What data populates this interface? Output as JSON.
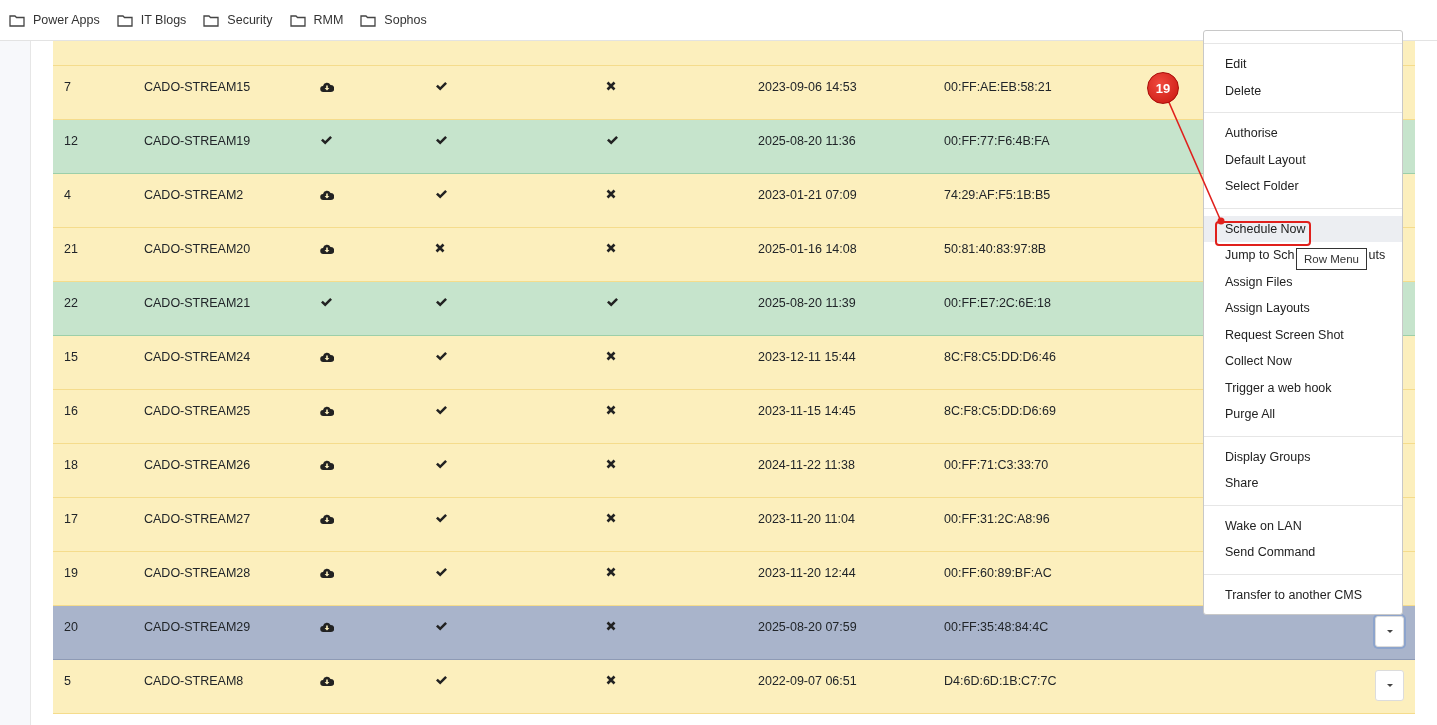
{
  "bookmarks": [
    {
      "label": "Power Apps"
    },
    {
      "label": "IT Blogs"
    },
    {
      "label": "Security"
    },
    {
      "label": "RMM"
    },
    {
      "label": "Sophos"
    }
  ],
  "rows": [
    {
      "id": "7",
      "name": "CADO-STREAM15",
      "kind": "warning",
      "selected": false,
      "flags": [
        {
          "kind": "cloud"
        },
        {
          "kind": "check"
        },
        {
          "kind": "cross"
        }
      ],
      "date": "2023-09-06 14:53",
      "mac": "00:FF:AE:EB:58:21"
    },
    {
      "id": "12",
      "name": "CADO-STREAM19",
      "kind": "success",
      "selected": false,
      "flags": [
        {
          "kind": "check"
        },
        {
          "kind": "check"
        },
        {
          "kind": "check"
        }
      ],
      "date": "2025-08-20 11:36",
      "mac": "00:FF:77:F6:4B:FA"
    },
    {
      "id": "4",
      "name": "CADO-STREAM2",
      "kind": "warning",
      "selected": false,
      "flags": [
        {
          "kind": "cloud"
        },
        {
          "kind": "check"
        },
        {
          "kind": "cross"
        }
      ],
      "date": "2023-01-21 07:09",
      "mac": "74:29:AF:F5:1B:B5"
    },
    {
      "id": "21",
      "name": "CADO-STREAM20",
      "kind": "warning",
      "selected": false,
      "flags": [
        {
          "kind": "cloud"
        },
        {
          "kind": "cross"
        },
        {
          "kind": "cross"
        }
      ],
      "date": "2025-01-16 14:08",
      "mac": "50:81:40:83:97:8B"
    },
    {
      "id": "22",
      "name": "CADO-STREAM21",
      "kind": "success",
      "selected": false,
      "flags": [
        {
          "kind": "check"
        },
        {
          "kind": "check"
        },
        {
          "kind": "check"
        }
      ],
      "date": "2025-08-20 11:39",
      "mac": "00:FF:E7:2C:6E:18"
    },
    {
      "id": "15",
      "name": "CADO-STREAM24",
      "kind": "warning",
      "selected": false,
      "flags": [
        {
          "kind": "cloud"
        },
        {
          "kind": "check"
        },
        {
          "kind": "cross"
        }
      ],
      "date": "2023-12-11 15:44",
      "mac": "8C:F8:C5:DD:D6:46"
    },
    {
      "id": "16",
      "name": "CADO-STREAM25",
      "kind": "warning",
      "selected": false,
      "flags": [
        {
          "kind": "cloud"
        },
        {
          "kind": "check"
        },
        {
          "kind": "cross"
        }
      ],
      "date": "2023-11-15 14:45",
      "mac": "8C:F8:C5:DD:D6:69"
    },
    {
      "id": "18",
      "name": "CADO-STREAM26",
      "kind": "warning",
      "selected": false,
      "flags": [
        {
          "kind": "cloud"
        },
        {
          "kind": "check"
        },
        {
          "kind": "cross"
        }
      ],
      "date": "2024-11-22 11:38",
      "mac": "00:FF:71:C3:33:70"
    },
    {
      "id": "17",
      "name": "CADO-STREAM27",
      "kind": "warning",
      "selected": false,
      "flags": [
        {
          "kind": "cloud"
        },
        {
          "kind": "check"
        },
        {
          "kind": "cross"
        }
      ],
      "date": "2023-11-20 11:04",
      "mac": "00:FF:31:2C:A8:96"
    },
    {
      "id": "19",
      "name": "CADO-STREAM28",
      "kind": "warning",
      "selected": false,
      "flags": [
        {
          "kind": "cloud"
        },
        {
          "kind": "check"
        },
        {
          "kind": "cross"
        }
      ],
      "date": "2023-11-20 12:44",
      "mac": "00:FF:60:89:BF:AC"
    },
    {
      "id": "20",
      "name": "CADO-STREAM29",
      "selected": true,
      "flags": [
        {
          "kind": "cloud"
        },
        {
          "kind": "check"
        },
        {
          "kind": "cross"
        }
      ],
      "date": "2025-08-20 07:59",
      "mac": "00:FF:35:48:84:4C",
      "menu_button": true
    },
    {
      "id": "5",
      "name": "CADO-STREAM8",
      "kind": "warning",
      "selected": false,
      "flags": [
        {
          "kind": "cloud"
        },
        {
          "kind": "check"
        },
        {
          "kind": "cross"
        }
      ],
      "date": "2022-09-07 06:51",
      "mac": "D4:6D:6D:1B:C7:7C",
      "menu_button": true
    }
  ],
  "row_menu": {
    "groups": [
      [
        {
          "label": "Edit",
          "highlighted": false
        },
        {
          "label": "Delete",
          "highlighted": false
        }
      ],
      [
        {
          "label": "Authorise",
          "highlighted": false
        },
        {
          "label": "Default Layout",
          "highlighted": false
        },
        {
          "label": "Select Folder",
          "highlighted": false
        }
      ],
      [
        {
          "label": "Schedule Now",
          "highlighted": true
        },
        {
          "label": "Jump to Sch",
          "label_tail": "uts",
          "highlighted": false
        },
        {
          "label": "Assign Files",
          "highlighted": false
        },
        {
          "label": "Assign Layouts",
          "highlighted": false
        },
        {
          "label": "Request Screen Shot",
          "highlighted": false
        },
        {
          "label": "Collect Now",
          "highlighted": false
        },
        {
          "label": "Trigger a web hook",
          "highlighted": false
        },
        {
          "label": "Purge All",
          "highlighted": false
        }
      ],
      [
        {
          "label": "Display Groups",
          "highlighted": false
        },
        {
          "label": "Share",
          "highlighted": false
        }
      ],
      [
        {
          "label": "Wake on LAN",
          "highlighted": false
        },
        {
          "label": "Send Command",
          "highlighted": false
        }
      ],
      [
        {
          "label": "Transfer to another CMS",
          "highlighted": false
        }
      ]
    ]
  },
  "tooltip": {
    "text": "Row Menu"
  },
  "callout": {
    "number": "19"
  }
}
